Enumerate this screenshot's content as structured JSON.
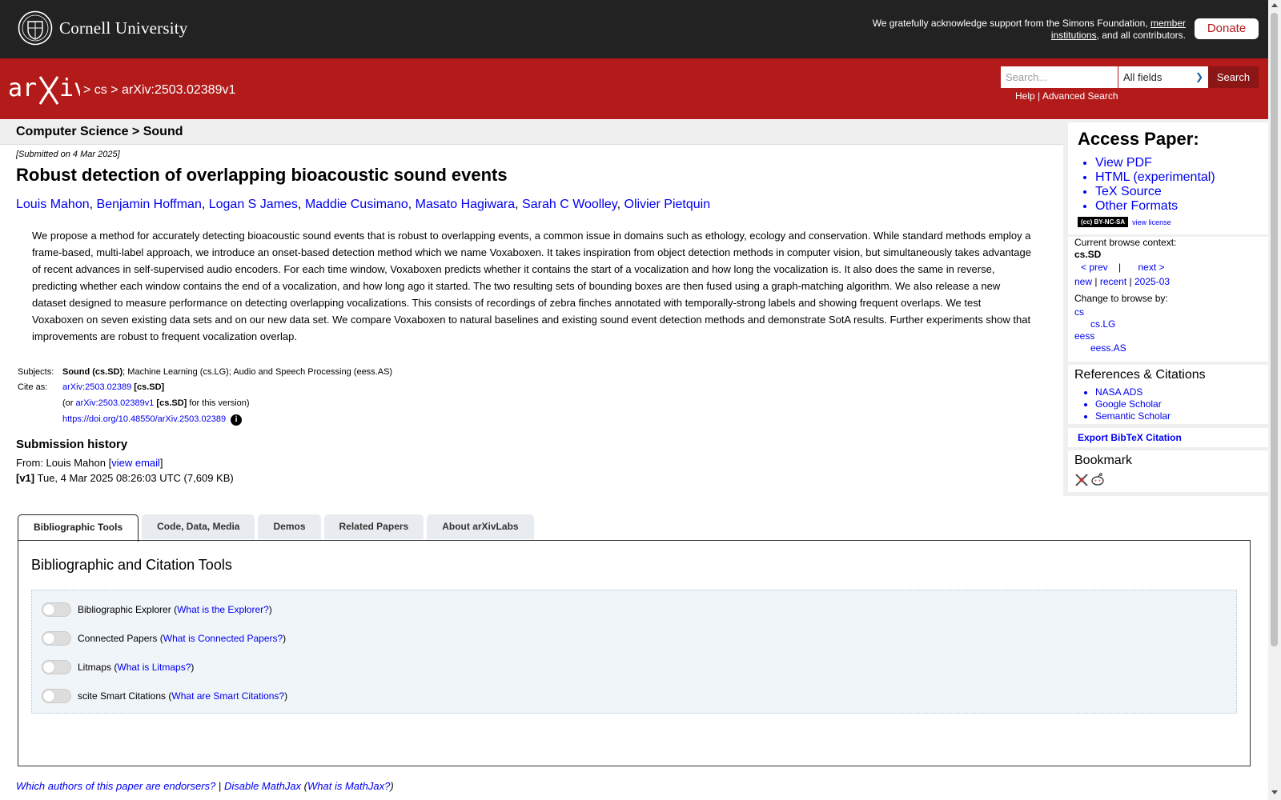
{
  "header": {
    "institution": "Cornell University",
    "ack_prefix": "We gratefully acknowledge support from the Simons Foundation, ",
    "ack_link": "member institutions",
    "ack_suffix": ", and all contributors.",
    "donate_label": "Donate"
  },
  "navbar": {
    "crumb_sep": ">",
    "crumb_cs": "cs",
    "crumb_id": "arXiv:2503.02389v1",
    "search_placeholder": "Search...",
    "search_field": "All fields",
    "search_label": "Search",
    "help": "Help",
    "help_sep": "|",
    "advanced": "Advanced Search"
  },
  "subject_header": "Computer Science > Sound",
  "paper": {
    "submitted": "[Submitted on 4 Mar 2025]",
    "title": "Robust detection of overlapping bioacoustic sound events",
    "authors": [
      "Louis Mahon",
      "Benjamin Hoffman",
      "Logan S James",
      "Maddie Cusimano",
      "Masato Hagiwara",
      "Sarah C Woolley",
      "Olivier Pietquin"
    ],
    "abstract": "We propose a method for accurately detecting bioacoustic sound events that is robust to overlapping events, a common issue in domains such as ethology, ecology and conservation. While standard methods employ a frame-based, multi-label approach, we introduce an onset-based detection method which we name Voxaboxen. It takes inspiration from object detection methods in computer vision, but simultaneously takes advantage of recent advances in self-supervised audio encoders. For each time window, Voxaboxen predicts whether it contains the start of a vocalization and how long the vocalization is. It also does the same in reverse, predicting whether each window contains the end of a vocalization, and how long ago it started. The two resulting sets of bounding boxes are then fused using a graph-matching algorithm. We also release a new dataset designed to measure performance on detecting overlapping vocalizations. This consists of recordings of zebra finches annotated with temporally-strong labels and showing frequent overlaps. We test Voxaboxen on seven existing data sets and on our new data set. We compare Voxaboxen to natural baselines and existing sound event detection methods and demonstrate SotA results. Further experiments show that improvements are robust to frequent vocalization overlap."
  },
  "meta": {
    "subjects_label": "Subjects:",
    "subject_primary": "Sound (cs.SD)",
    "subject_rest": "; Machine Learning (cs.LG); Audio and Speech Processing (eess.AS)",
    "cite_label": "Cite as:",
    "cite_id": "arXiv:2503.02389",
    "cite_cat": "[cs.SD]",
    "version_prefix": "(or ",
    "version_id": "arXiv:2503.02389v1",
    "version_cat": "[cs.SD]",
    "version_suffix": " for this version)",
    "doi": "https://doi.org/10.48550/arXiv.2503.02389"
  },
  "history": {
    "heading": "Submission history",
    "from_prefix": "From: Louis Mahon [",
    "view_email": "view email",
    "from_suffix": "]",
    "v1_label": "[v1]",
    "v1_text": " Tue, 4 Mar 2025 08:26:03 UTC (7,609 KB)"
  },
  "sidebar": {
    "access_heading": "Access Paper:",
    "access_links": [
      "View PDF",
      "HTML (experimental)",
      "TeX Source",
      "Other Formats"
    ],
    "license_badge": "(cc) BY-NC-SA",
    "view_license": "view license",
    "context_label": "Current browse context:",
    "context_value": "cs.SD",
    "prev": "< prev",
    "nav_sep": "|",
    "next": "next >",
    "new": "new",
    "recent": "recent",
    "month": "2025-03",
    "change_label": "Change to browse by:",
    "browse": [
      "cs",
      "cs.LG",
      "eess",
      "eess.AS"
    ],
    "refs_heading": "References & Citations",
    "refs": [
      "NASA ADS",
      "Google Scholar",
      "Semantic Scholar"
    ],
    "export": "Export BibTeX Citation",
    "bookmark_heading": "Bookmark"
  },
  "tabs": [
    "Bibliographic Tools",
    "Code, Data, Media",
    "Demos",
    "Related Papers",
    "About arXivLabs"
  ],
  "tools": {
    "heading": "Bibliographic and Citation Tools",
    "items": [
      {
        "name": "Bibliographic Explorer",
        "help": "What is the Explorer?"
      },
      {
        "name": "Connected Papers",
        "help": "What is Connected Papers?"
      },
      {
        "name": "Litmaps",
        "help": "What is Litmaps?"
      },
      {
        "name": "scite Smart Citations",
        "help": "What are Smart Citations?"
      }
    ]
  },
  "footer": {
    "endorsers": "Which authors of this paper are endorsers?",
    "sep": "|",
    "disable_mathjax": "Disable MathJax",
    "what_mathjax": "What is MathJax?"
  },
  "colors": {
    "topbar": "#222222",
    "arxiv_red": "#b31b1b",
    "link": "#0000ee"
  }
}
